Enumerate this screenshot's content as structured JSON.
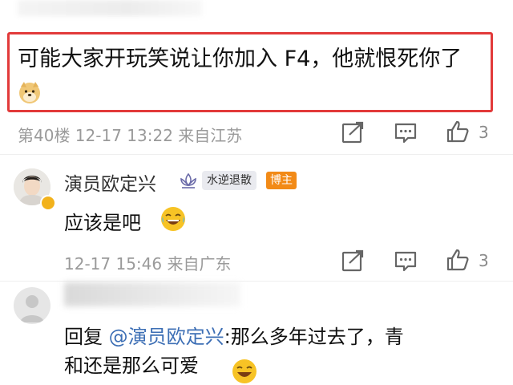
{
  "post": {
    "text": "可能大家开玩笑说让你加入 F4，他就恨死你了",
    "emoji_icon": "doge-emoji-icon",
    "meta": "第40楼 12-17 13:22 来自江苏",
    "like_count": "3"
  },
  "reply1": {
    "username": "演员欧定兴",
    "group_tag": "水逆退散",
    "owner_badge": "博主",
    "text": "应该是吧",
    "meta": "12-17 15:46 来自广东",
    "like_count": "3"
  },
  "reply2": {
    "reply_prefix": "回复",
    "mention": "@演员欧定兴",
    "line1_rest": ":那么多年过去了，青",
    "line2": "和还是那么可爱"
  },
  "colors": {
    "highlight": "#e23a3a",
    "mention": "#3d6fb5",
    "owner_badge": "#f28a17",
    "meta_text": "#9a9a9a"
  }
}
